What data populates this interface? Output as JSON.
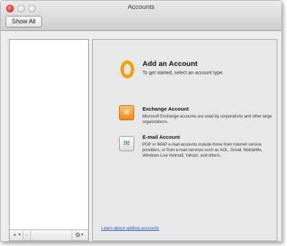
{
  "window": {
    "title": "Accounts",
    "show_all_label": "Show All"
  },
  "sidebar": {
    "add_label": "+",
    "remove_label": "−",
    "caret": "▾",
    "gear_label": "⚙"
  },
  "main": {
    "heading": "Add an Account",
    "subheading": "To get started, select an account type.",
    "options": [
      {
        "title": "Exchange Account",
        "description": "Microsoft Exchange accounts are used by corporations and other large organizations.",
        "icon": "exchange-icon"
      },
      {
        "title": "E-mail Account",
        "description": "POP or IMAP e-mail accounts include those from Internet service providers, or from e-mail services such as AOL, Gmail, MobileMe, Windows Live Hotmail, Yahoo!, and others.",
        "icon": "email-icon"
      }
    ],
    "learn_link": "Learn about adding accounts"
  },
  "colors": {
    "logo_orange": "#f3a200",
    "link_blue": "#2b57c9"
  }
}
